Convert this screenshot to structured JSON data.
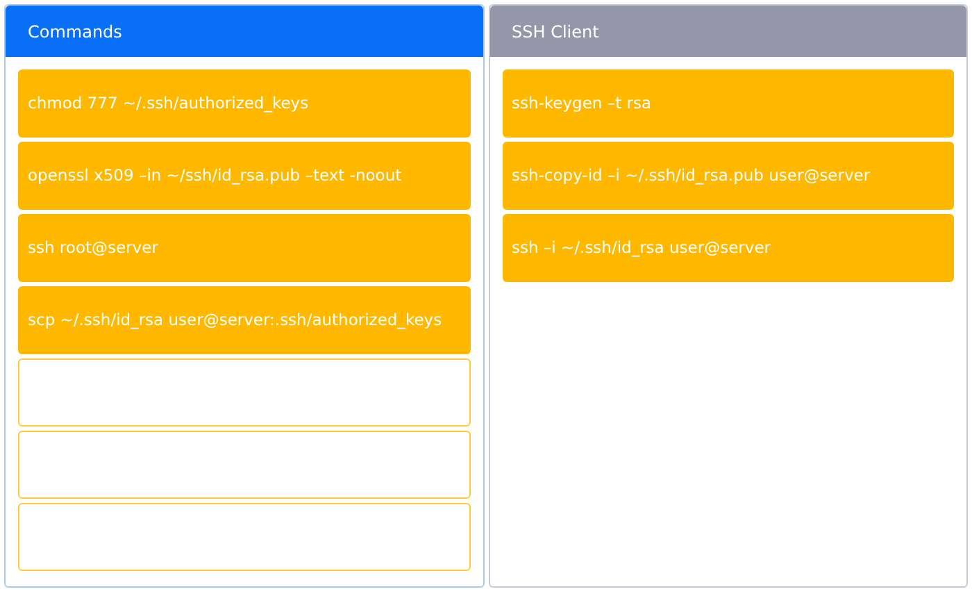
{
  "panels": [
    {
      "title": "Commands",
      "kind": "source",
      "items": [
        {
          "kind": "filled",
          "text": "chmod 777 ~/.ssh/authorized_keys"
        },
        {
          "kind": "filled",
          "text": "openssl x509 –in ~/ssh/id_rsa.pub –text -noout"
        },
        {
          "kind": "filled",
          "text": "ssh root@server"
        },
        {
          "kind": "filled",
          "text": "scp ~/.ssh/id_rsa user@server:.ssh/authorized_keys"
        },
        {
          "kind": "empty"
        },
        {
          "kind": "empty"
        },
        {
          "kind": "empty"
        }
      ]
    },
    {
      "title": "SSH Client",
      "kind": "target",
      "items": [
        {
          "kind": "filled",
          "text": "ssh-keygen –t rsa"
        },
        {
          "kind": "filled",
          "text": "ssh-copy-id –i ~/.ssh/id_rsa.pub user@server"
        },
        {
          "kind": "filled",
          "text": "ssh –i ~/.ssh/id_rsa user@server"
        }
      ]
    }
  ]
}
